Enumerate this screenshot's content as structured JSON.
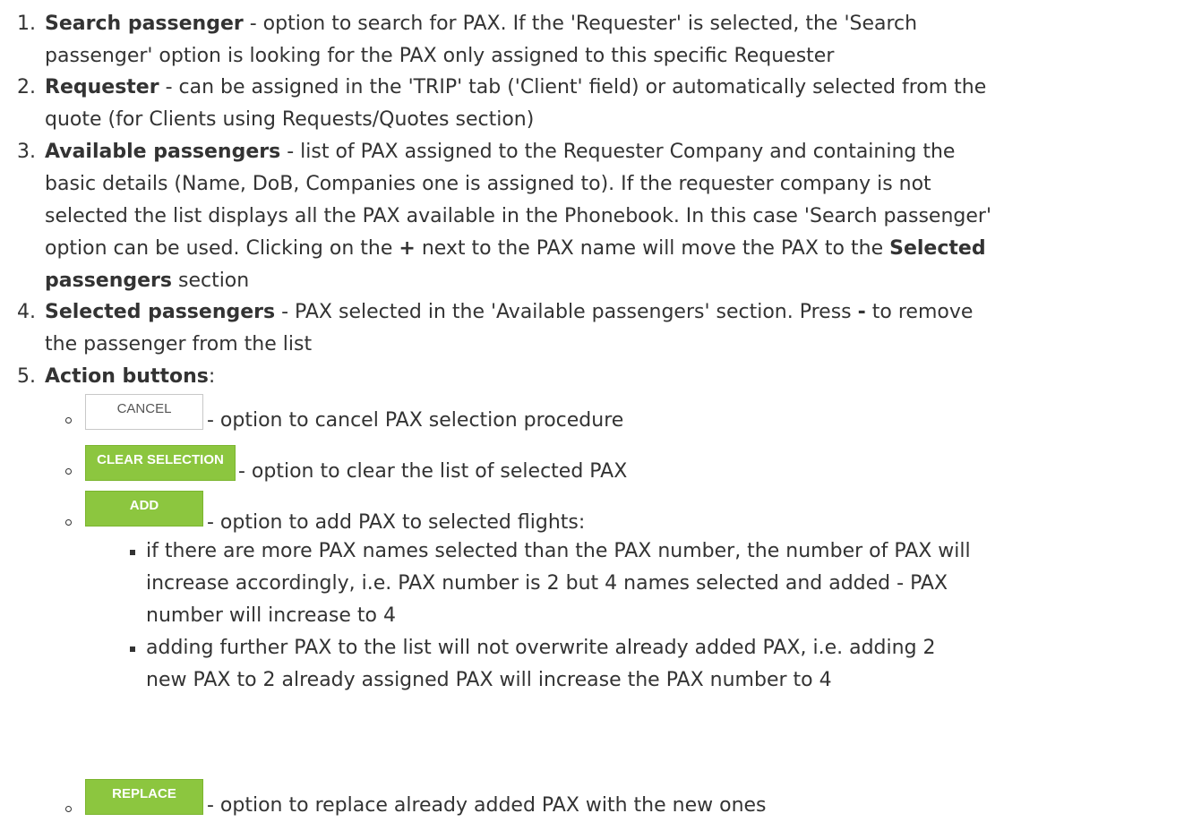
{
  "items": [
    {
      "num": "1.",
      "title": "Search passenger",
      "line1": " - option to search for PAX. If the 'Requester' is selected, the 'Search",
      "line2": "passenger' option is looking for the PAX only assigned to this specific Requester"
    },
    {
      "num": "2.",
      "title": "Requester",
      "line1": " - can be assigned in the 'TRIP' tab ('Client' field) or automatically selected from the",
      "line2": "quote (for Clients using Requests/Quotes section)"
    },
    {
      "num": "3.",
      "title": "Available passengers",
      "line1": " - list of PAX assigned to the Requester Company and containing the",
      "line2": "basic details (Name, DoB, Companies one is assigned to). If the requester company is not",
      "line3": "selected the list displays all the PAX available in the Phonebook. In this case 'Search passenger'",
      "line4a": "option can be used. Clicking on the ",
      "line4plus": "+",
      "line4b": " next to the PAX name will move the PAX to the ",
      "line4bold": "Selected",
      "line5bold": "passengers",
      "line5": " section"
    },
    {
      "num": "4.",
      "title": "Selected passengers",
      "line1a": " - PAX selected in the 'Available passengers' section. Press ",
      "line1minus": "-",
      "line1b": " to remove",
      "line2": "the passenger from the list"
    },
    {
      "num": "5.",
      "title": "Action buttons",
      "after": ":"
    }
  ],
  "buttons": {
    "cancel": {
      "label": "CANCEL",
      "desc": " - option to cancel PAX selection procedure"
    },
    "clear": {
      "label": "CLEAR SELECTION",
      "desc": " - option to clear the list of selected PAX"
    },
    "add": {
      "label": "ADD",
      "desc": " - option to add PAX to selected flights:"
    },
    "replace": {
      "label": "REPLACE",
      "desc": " - option to replace already added PAX with the new ones"
    }
  },
  "add_bullets": [
    {
      "l1": "if there are more PAX names selected than the PAX number, the number of PAX will",
      "l2": "increase accordingly, i.e. PAX number is 2 but 4 names selected and added - PAX",
      "l3": "number will increase to 4"
    },
    {
      "l1": "adding further PAX to the list will not overwrite already added PAX, i.e. adding 2",
      "l2": "new PAX to 2 already assigned PAX will increase the PAX number to 4"
    }
  ],
  "colors": {
    "button_green": "#8cc63f",
    "text": "#333333"
  }
}
